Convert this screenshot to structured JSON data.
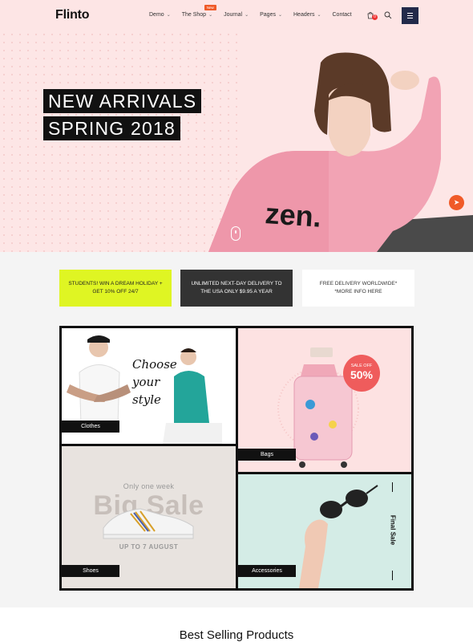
{
  "header": {
    "logo": "Flinto",
    "nav": [
      {
        "label": "Demo",
        "chevron": true
      },
      {
        "label": "The Shop",
        "chevron": true,
        "badge": "New"
      },
      {
        "label": "Journal",
        "chevron": true
      },
      {
        "label": "Pages",
        "chevron": true
      },
      {
        "label": "Headers",
        "chevron": true
      },
      {
        "label": "Contact",
        "chevron": false
      }
    ],
    "cart_count": "0",
    "accent": "#f05a28",
    "menu_bg": "#222a4a"
  },
  "hero": {
    "line1": "NEW ARRIVALS",
    "line2": "SPRING 2018",
    "bg": "#fde6e6"
  },
  "promos": [
    {
      "text": "STUDENTS! WIN A DREAM HOLIDAY + GET 10% OFF 24/7",
      "bg": "#dff523"
    },
    {
      "text": "UNLIMITED NEXT-DAY DELIVERY TO THE USA ONLY $9.95 A YEAR",
      "bg": "#333333"
    },
    {
      "text": "FREE DELIVERY WORLDWIDE* *MORE INFO HERE",
      "bg": "#ffffff"
    }
  ],
  "categories": {
    "clothes": {
      "label": "Clothes",
      "headline": [
        "Choose",
        "your",
        "style"
      ]
    },
    "bags": {
      "label": "Bags",
      "sale_top": "SALE OFF",
      "sale_value": "50%"
    },
    "shoes": {
      "label": "Shoes",
      "kicker": "Only one week",
      "headline": "Big Sale",
      "sub": "UP TO 7 AUGUST"
    },
    "accessories": {
      "label": "Accessories",
      "side_text": "Final Sale"
    }
  },
  "section": {
    "best_selling": "Best Selling Products"
  }
}
